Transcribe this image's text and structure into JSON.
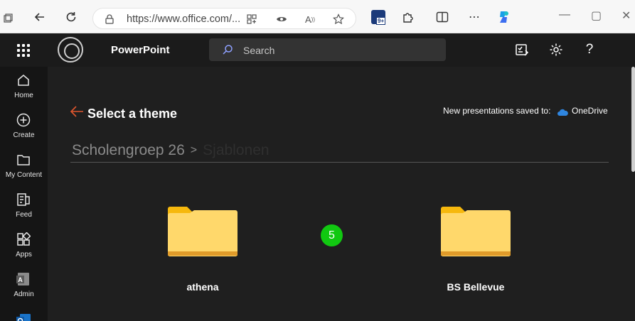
{
  "browser": {
    "url": "https://www.office.com/...",
    "extension_badge": "9+"
  },
  "header": {
    "app_name": "PowerPoint",
    "search_placeholder": "Search"
  },
  "rail": {
    "items": [
      {
        "label": "Home",
        "icon": "home-icon"
      },
      {
        "label": "Create",
        "icon": "plus-circle-icon"
      },
      {
        "label": "My Content",
        "icon": "folder-icon"
      },
      {
        "label": "Feed",
        "icon": "feed-icon"
      },
      {
        "label": "Apps",
        "icon": "apps-icon"
      },
      {
        "label": "Admin",
        "icon": "admin-icon"
      }
    ]
  },
  "main": {
    "title": "Select a theme",
    "saved_to_label": "New presentations saved to:",
    "saved_to_location": "OneDrive",
    "breadcrumb": [
      "Scholengroep 26",
      "Sjablonen"
    ],
    "folders": [
      {
        "name": "athena"
      },
      {
        "name": "BS Bellevue"
      }
    ]
  },
  "overlay_badge": "5",
  "colors": {
    "accent_arrow": "#e0562e",
    "folder_fill": "#ffd86b",
    "folder_tab": "#f6b80d",
    "badge_green": "#11c811"
  }
}
